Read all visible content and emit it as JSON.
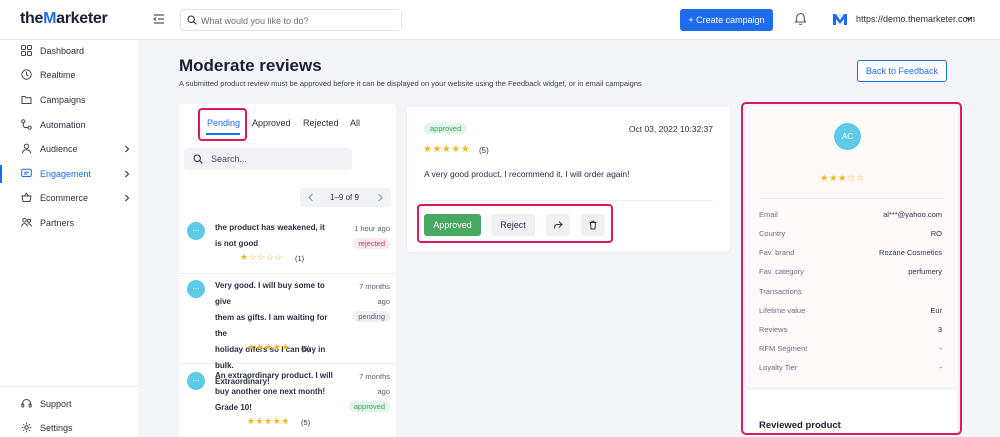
{
  "header": {
    "logo_prefix": "the",
    "logo_m": "M",
    "logo_suffix": "arketer",
    "search_placeholder": "What would you like to do?",
    "create_label": "+ Create campaign",
    "account_url": "https://demo.themarketer.com"
  },
  "colors": {
    "accent": "#1d6cf0",
    "approved": "#49a963",
    "highlight": "#e0195a",
    "avatar": "#5dcbe5",
    "star": "#f2b623"
  },
  "sidebar": {
    "items": [
      {
        "label": "Dashboard",
        "icon": "grid-icon"
      },
      {
        "label": "Realtime",
        "icon": "clock-icon"
      },
      {
        "label": "Campaigns",
        "icon": "folder-icon"
      },
      {
        "label": "Automation",
        "icon": "flow-icon"
      },
      {
        "label": "Audience",
        "icon": "user-icon"
      },
      {
        "label": "Engagement",
        "icon": "chat-icon"
      },
      {
        "label": "Ecommerce",
        "icon": "basket-icon"
      },
      {
        "label": "Partners",
        "icon": "partners-icon"
      }
    ],
    "footer": [
      {
        "label": "Support",
        "icon": "headset-icon"
      },
      {
        "label": "Settings",
        "icon": "gear-icon"
      }
    ]
  },
  "page": {
    "title": "Moderate reviews",
    "subtitle": "A submitted product review must be approved before it can be displayed on your website using the Feedback widget, or in email campaigns",
    "back_label": "Back to Feedback"
  },
  "tabs": [
    "Pending",
    "Approved",
    "Rejected",
    "All"
  ],
  "list": {
    "search_placeholder": "Search...",
    "pager": "1–9 of 9",
    "reviews": [
      {
        "avatar": "...",
        "lines": [
          "the product has weakened, it",
          "is not good"
        ],
        "date": [
          "1 hour ago"
        ],
        "status": "rejected",
        "stars": "★☆☆☆☆",
        "count": "(1)"
      },
      {
        "avatar": "...",
        "lines": [
          "Very good. I will buy some to give",
          "them as gifts. I am waiting for the",
          "holiday offers so I can buy in bulk.",
          "Extraordinary!"
        ],
        "date": [
          "7 months",
          "ago"
        ],
        "status": "pending",
        "stars": "★★★★★",
        "count": "(5)"
      },
      {
        "avatar": "...",
        "lines": [
          "An extraordinary product. I will",
          "buy another one next month!",
          "Grade 10!"
        ],
        "date": [
          "7 months",
          "ago"
        ],
        "status": "approved",
        "stars": "★★★★★",
        "count": "(5)"
      }
    ]
  },
  "detail": {
    "status": "approved",
    "date": "Oct 03, 2022 10:32:37",
    "stars": "★★★★★",
    "count": "(5)",
    "text": "A very good product, I recommend it, I will order again!",
    "approve_label": "Approved",
    "reject_label": "Reject"
  },
  "customer": {
    "initials": "AC",
    "stars": "★★★☆☆",
    "fields": [
      {
        "key": "Email",
        "value": "al***@yahoo.com"
      },
      {
        "key": "Country",
        "value": "RO"
      },
      {
        "key": "Fav. brand",
        "value": "Rozane Cosmetics"
      },
      {
        "key": "Fav. category",
        "value": "perfumery"
      },
      {
        "key": "Transactions",
        "value": ""
      },
      {
        "key": "Lifetime value",
        "value": "Eur"
      },
      {
        "key": "Reviews",
        "value": "3"
      },
      {
        "key": "RFM Segment",
        "value": "-"
      },
      {
        "key": "Loyalty Tier",
        "value": "-"
      }
    ],
    "reviewed_title": "Reviewed product"
  }
}
